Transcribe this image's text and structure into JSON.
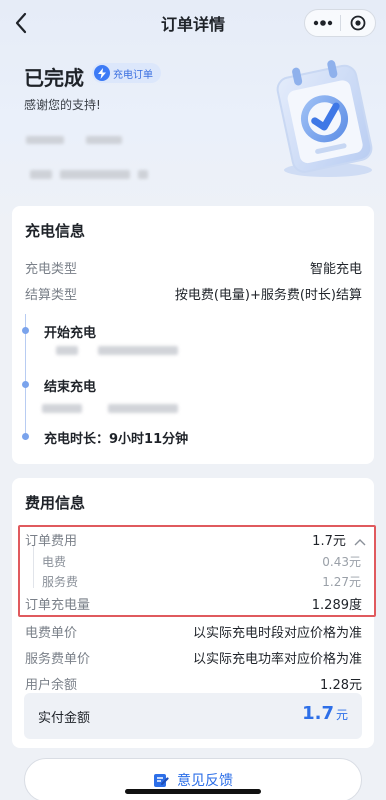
{
  "nav": {
    "title": "订单详情"
  },
  "header": {
    "status": "已完成",
    "badge": "充电订单",
    "thanks": "感谢您的支持!"
  },
  "charging": {
    "title": "充电信息",
    "rows": [
      {
        "label": "充电类型",
        "value": "智能充电"
      },
      {
        "label": "结算类型",
        "value": "按电费(电量)+服务费(时长)结算"
      }
    ],
    "timeline": {
      "start": "开始充电",
      "end": "结束充电",
      "duration": "充电时长：9小时11分钟"
    }
  },
  "fees": {
    "title": "费用信息",
    "order_fee": {
      "label": "订单费用",
      "value": "1.7元"
    },
    "breakdown": [
      {
        "label": "电费",
        "value": "0.43元"
      },
      {
        "label": "服务费",
        "value": "1.27元"
      }
    ],
    "energy": {
      "label": "订单充电量",
      "value": "1.289度"
    },
    "rows": [
      {
        "label": "电费单价",
        "value": "以实际充电时段对应价格为准"
      },
      {
        "label": "服务费单价",
        "value": "以实际充电功率对应价格为准"
      },
      {
        "label": "用户余额",
        "value": "1.28元"
      }
    ],
    "paid": {
      "label": "实付金额",
      "amount": "1.7",
      "unit": "元"
    }
  },
  "feedback": {
    "label": "意见反馈"
  },
  "colors": {
    "accent": "#2d6fe8",
    "highlight": "#e05a5e"
  }
}
